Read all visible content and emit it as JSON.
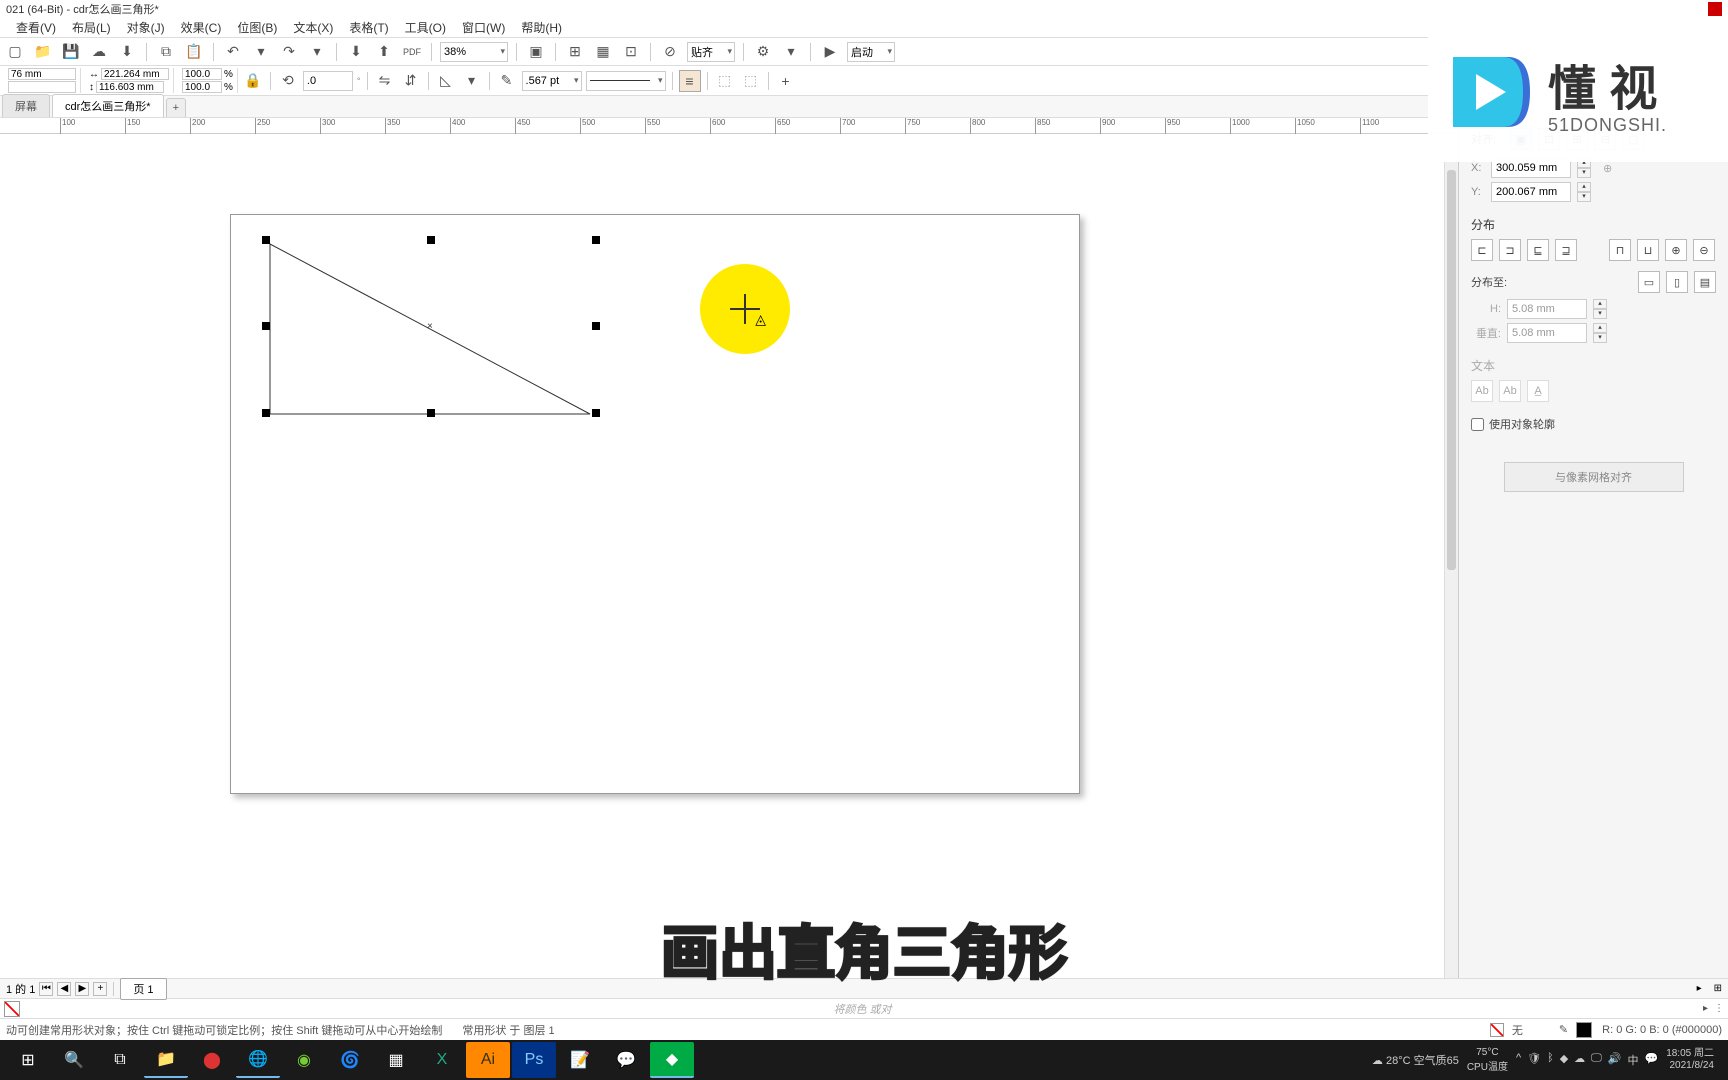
{
  "title": "021 (64-Bit) - cdr怎么画三角形*",
  "menu": [
    "查看(V)",
    "布局(L)",
    "对象(J)",
    "效果(C)",
    "位图(B)",
    "文本(X)",
    "表格(T)",
    "工具(O)",
    "窗口(W)",
    "帮助(H)"
  ],
  "toolbar": {
    "zoom": "38%",
    "snap_label": "贴齐",
    "launch_label": "启动"
  },
  "prop_bar": {
    "x": "76 mm",
    "y": "",
    "w": "221.264 mm",
    "h": "116.603 mm",
    "scale_x": "100.0",
    "scale_y": "100.0",
    "rotation": ".0",
    "stroke_width": ".567 pt",
    "pct": "%"
  },
  "tabs": {
    "tab1": "屏幕",
    "tab2": "cdr怎么画三角形*"
  },
  "ruler_ticks": [
    "100",
    "150",
    "200",
    "250",
    "300",
    "350",
    "400",
    "450",
    "500",
    "550",
    "600",
    "650",
    "700",
    "750",
    "800",
    "850",
    "900",
    "950",
    "1000",
    "1050",
    "1100"
  ],
  "right_panel": {
    "align_label": "对齐:",
    "x_label": "X:",
    "y_label": "Y:",
    "x_val": "300.059 mm",
    "y_val": "200.067 mm",
    "dist_label": "分布",
    "dist_to_label": "分布至:",
    "h_label": "H:",
    "v_label": "垂直:",
    "h_val": "5.08 mm",
    "v_val": "5.08 mm",
    "text_label": "文本",
    "checkbox_label": "使用对象轮廓",
    "button_label": "与像素网格对齐"
  },
  "watermark": {
    "text": "懂 视",
    "sub": "51DONGSHI."
  },
  "page_nav": {
    "info": "1 的 1",
    "page_tab": "页 1"
  },
  "color_hint": "将颜色 或对",
  "subtitle": "画出直角三角形",
  "status": {
    "left": "动可创建常用形状对象；按住 Ctrl 键拖动可锁定比例；按住 Shift 键拖动可从中心开始绘制",
    "center": "常用形状 于 图层 1",
    "fill": "无",
    "rgb": "R: 0 G: 0 B: 0 (#000000)"
  },
  "taskbar": {
    "weather": "28°C 空气质65",
    "cpu": "CPU温度",
    "temp": "75°C",
    "time": "18:05 周二",
    "date": "2021/8/24"
  }
}
